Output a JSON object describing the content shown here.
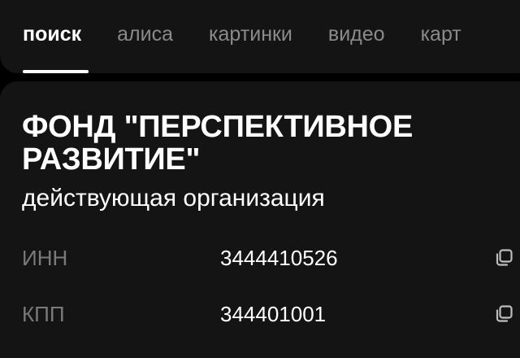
{
  "nav": {
    "tabs": [
      {
        "label": "поиск",
        "active": true
      },
      {
        "label": "алиса",
        "active": false
      },
      {
        "label": "картинки",
        "active": false
      },
      {
        "label": "видео",
        "active": false
      },
      {
        "label": "карт",
        "active": false
      }
    ]
  },
  "organization": {
    "name": "ФОНД \"ПЕРСПЕКТИВНОЕ РАЗВИТИЕ\"",
    "status": "действующая организация",
    "details": [
      {
        "label": "ИНН",
        "value": "3444410526",
        "icon": "copy-icon"
      },
      {
        "label": "КПП",
        "value": "344401001",
        "icon": "copy-icon"
      }
    ]
  },
  "colors": {
    "background": "#000000",
    "card": "#141414",
    "text_primary": "#ffffff",
    "text_secondary": "#8a8a8a"
  }
}
